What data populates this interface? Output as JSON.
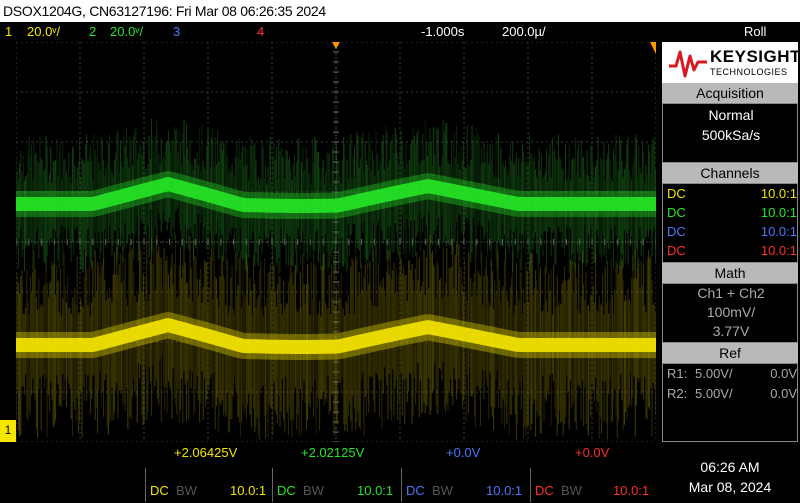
{
  "title": "DSOX1204G, CN63127196: Fri Mar 08 06:26:35 2024",
  "channel_bar": {
    "ch1_num": "1",
    "ch1_scale": "20.0ᵛ/",
    "ch2_num": "2",
    "ch2_scale": "20.0ᵛ/",
    "ch3_num": "3",
    "ch4_num": "4",
    "time_offset": "-1.000s",
    "time_scale": "200.0µ/",
    "mode": "Roll"
  },
  "colors": {
    "ch1": "#f5e600",
    "ch2": "#26e526",
    "ch3": "#4a78ff",
    "ch4": "#ff2d2d",
    "trigger": "#ff9900",
    "panel_header": "#b9b9b9"
  },
  "panel": {
    "brand": "KEYSIGHT",
    "brand_sub": "TECHNOLOGIES",
    "acquisition": {
      "header": "Acquisition",
      "mode": "Normal",
      "rate": "500kSa/s"
    },
    "channels": {
      "header": "Channels",
      "rows": [
        {
          "coupling": "DC",
          "probe": "10.0:1"
        },
        {
          "coupling": "DC",
          "probe": "10.0:1"
        },
        {
          "coupling": "DC",
          "probe": "10.0:1"
        },
        {
          "coupling": "DC",
          "probe": "10.0:1"
        }
      ]
    },
    "math": {
      "header": "Math",
      "expr": "Ch1 + Ch2",
      "scale": "100mV/",
      "offset": "3.77V"
    },
    "ref": {
      "header": "Ref",
      "r1": {
        "label": "R1:",
        "scale": "5.00V/",
        "offset": "0.0V"
      },
      "r2": {
        "label": "R2:",
        "scale": "5.00V/",
        "offset": "0.0V"
      }
    }
  },
  "ground_marker": "1",
  "bottom": {
    "ch1": {
      "value": "+2.06425V",
      "coupling": "DC",
      "bw": "BW",
      "probe": "10.0:1"
    },
    "ch2": {
      "value": "+2.02125V",
      "coupling": "DC",
      "bw": "BW",
      "probe": "10.0:1"
    },
    "ch3": {
      "value": "+0.0V",
      "coupling": "DC",
      "bw": "BW",
      "probe": "10.0:1"
    },
    "ch4": {
      "value": "+0.0V",
      "coupling": "DC",
      "bw": "BW",
      "probe": "10.0:1"
    },
    "time": "06:26 AM",
    "date": "Mar 08, 2024"
  }
}
